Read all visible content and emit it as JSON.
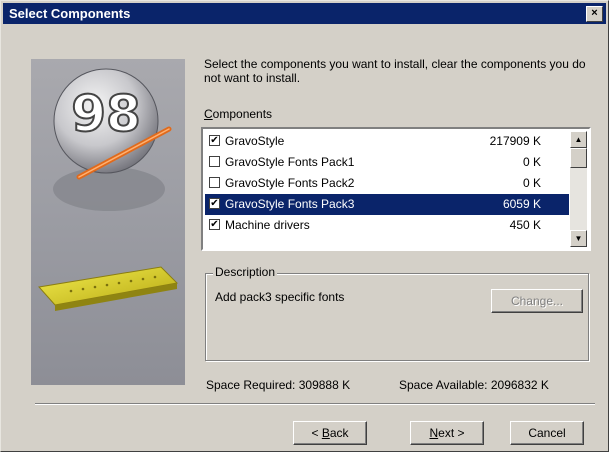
{
  "window": {
    "title": "Select Components",
    "close_glyph": "×"
  },
  "intro_text": "Select the components you want to install, clear the components you do not want to install.",
  "components": {
    "label_mnemonic": "C",
    "label_rest": "omponents",
    "items": [
      {
        "label": "GravoStyle",
        "size": "217909 K",
        "checked": true,
        "selected": false
      },
      {
        "label": "GravoStyle Fonts Pack1",
        "size": "0 K",
        "checked": false,
        "selected": false
      },
      {
        "label": "GravoStyle Fonts Pack2",
        "size": "0 K",
        "checked": false,
        "selected": false
      },
      {
        "label": "GravoStyle Fonts Pack3",
        "size": "6059 K",
        "checked": true,
        "selected": true
      },
      {
        "label": "Machine drivers",
        "size": "450 K",
        "checked": true,
        "selected": false
      }
    ],
    "scroll_up_glyph": "▲",
    "scroll_down_glyph": "▼"
  },
  "description": {
    "title": "Description",
    "text": "Add pack3 specific fonts",
    "change_button": "Change..."
  },
  "space": {
    "required_label": "Space Required:",
    "required_value": "309888 K",
    "available_label": "Space Available:",
    "available_value": "2096832 K"
  },
  "buttons": {
    "back_prefix": "< ",
    "back_mnemonic": "B",
    "back_rest": "ack",
    "next_mnemonic": "N",
    "next_rest": "ext >",
    "cancel": "Cancel"
  },
  "art": {
    "logo_text": "98"
  },
  "colors": {
    "selection": "#0a246a",
    "face": "#d4d0c8",
    "titlebar": "#0a246a"
  }
}
